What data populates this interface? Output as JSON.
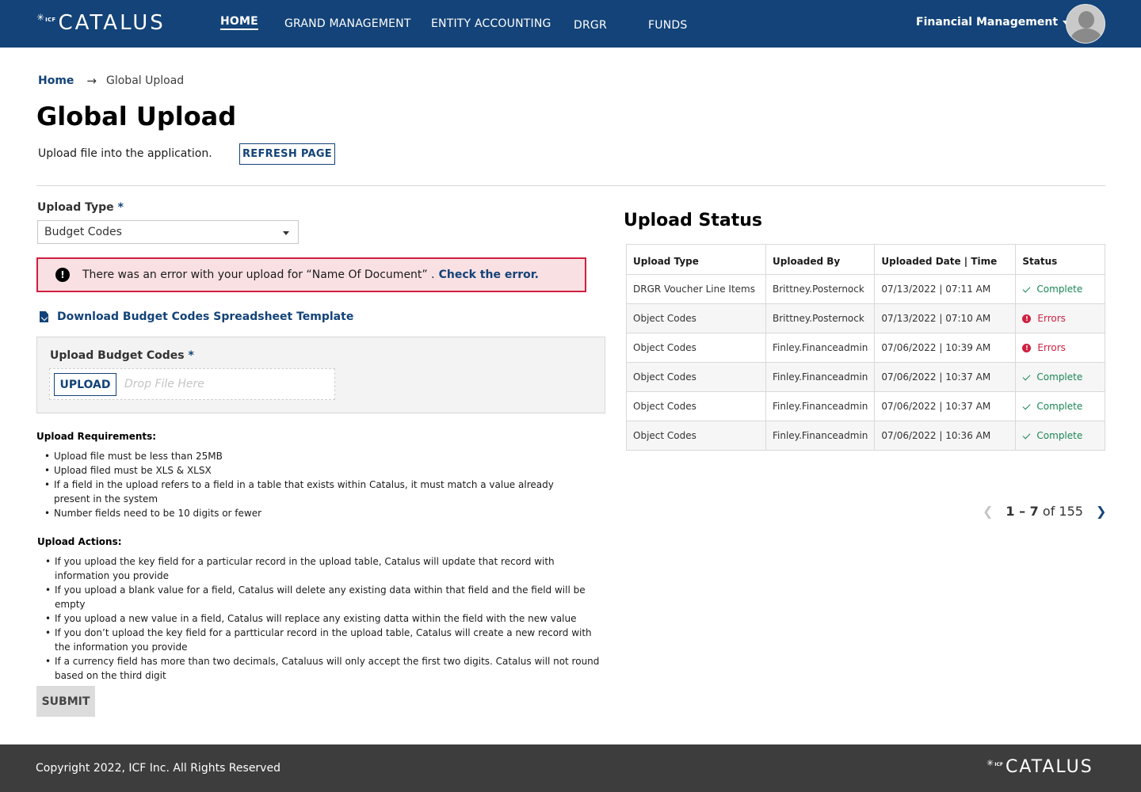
{
  "header": {
    "brand": {
      "prefix": "ICF",
      "name": "CATALUS"
    },
    "nav": [
      {
        "label": "HOME",
        "active": true
      },
      {
        "label": "GRAND MANAGEMENT",
        "active": false
      },
      {
        "label": "ENTITY ACCOUNTING",
        "active": false
      },
      {
        "label": "DRGR",
        "active": false
      },
      {
        "label": "FUNDS",
        "active": false
      }
    ],
    "user_menu": "Financial Management"
  },
  "breadcrumb": {
    "home": "Home",
    "current": "Global Upload"
  },
  "page": {
    "title": "Global Upload",
    "subtitle": "Upload file into the application.",
    "refresh_label": "REFRESH PAGE"
  },
  "upload_form": {
    "type_label": "Upload Type",
    "required_mark": "*",
    "type_value": "Budget Codes",
    "alert": {
      "message": "There was an error with your upload for “Name Of Document” .",
      "link": "Check the error."
    },
    "download_label": "Download Budget Codes Spreadsheet Template",
    "file_label": "Upload Budget Codes",
    "upload_button": "UPLOAD",
    "drop_placeholder": "Drop File Here",
    "requirements_heading": "Upload Requirements:",
    "requirements": [
      "Upload file must be less than 25MB",
      "Upload filed must be XLS & XLSX",
      "If a field in the upload refers to a field in a table that exists within Catalus, it must match a value already present in the system",
      "Number fields need to be 10 digits or fewer"
    ],
    "actions_heading": "Upload Actions:",
    "actions": [
      "If you upload the key field for a particular record in the upload table, Catalus will update that record with information you provide",
      "If you upload a blank value for a field, Catalus will delete any existing data within that field and the field will be empty",
      "If you upload a new value in a field, Catalus will replace any existing datta within the field with the new value",
      "If you don’t upload the key field for a partticular record in the upload table, Catalus will create a new record with the information you provide",
      "If a currency field has more than two decimals, Cataluus will only accept the first two digits. Catalus will not round based on the third digit"
    ],
    "submit_label": "SUBMIT"
  },
  "upload_status": {
    "title": "Upload Status",
    "columns": [
      "Upload Type",
      "Uploaded By",
      "Uploaded Date | Time",
      "Status"
    ],
    "rows": [
      {
        "type": "DRGR Voucher Line Items",
        "by": "Brittney.Posternock",
        "datetime": "07/13/2022 | 07:11 AM",
        "status": "Complete"
      },
      {
        "type": "Object Codes",
        "by": "Brittney.Posternock",
        "datetime": "07/13/2022 | 07:10 AM",
        "status": "Errors"
      },
      {
        "type": "Object Codes",
        "by": "Finley.Financeadmin",
        "datetime": "07/06/2022 | 10:39 AM",
        "status": "Errors"
      },
      {
        "type": "Object Codes",
        "by": "Finley.Financeadmin",
        "datetime": "07/06/2022 | 10:37 AM",
        "status": "Complete"
      },
      {
        "type": "Object Codes",
        "by": "Finley.Financeadmin",
        "datetime": "07/06/2022 | 10:37 AM",
        "status": "Complete"
      },
      {
        "type": "Object Codes",
        "by": "Finley.Financeadmin",
        "datetime": "07/06/2022 | 10:36 AM",
        "status": "Complete"
      }
    ],
    "pagination": {
      "range": "1 – 7",
      "of_label": "of",
      "total": "155"
    }
  },
  "footer": {
    "copyright": "Copyright 2022, ICF Inc. All Rights Reserved",
    "brand": {
      "prefix": "ICF",
      "name": "CATALUS"
    }
  },
  "colors": {
    "primary": "#134378",
    "error": "#cf2040",
    "success": "#1a8755",
    "footer": "#3d3d3d"
  }
}
